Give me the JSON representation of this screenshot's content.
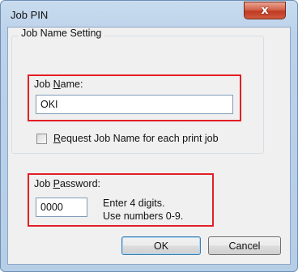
{
  "window": {
    "title": "Job PIN",
    "close_glyph": "x"
  },
  "job_name_group": {
    "title": "Job Name Setting",
    "job_name_label_pre": "Job ",
    "job_name_label_key": "N",
    "job_name_label_post": "ame:",
    "job_name_value": "OKI",
    "request_checkbox_label_key": "R",
    "request_checkbox_label_post": "equest Job Name for each print job",
    "request_checked": false
  },
  "password": {
    "label_pre": "Job ",
    "label_key": "P",
    "label_post": "assword:",
    "value": "0000",
    "hint_line1": "Enter 4 digits.",
    "hint_line2": "Use numbers 0-9."
  },
  "buttons": {
    "ok_label": "OK",
    "cancel_label": "Cancel"
  },
  "colors": {
    "highlight_box": "#e21f26",
    "title_bar": "#bcd2ea",
    "close_button": "#c03a22"
  }
}
